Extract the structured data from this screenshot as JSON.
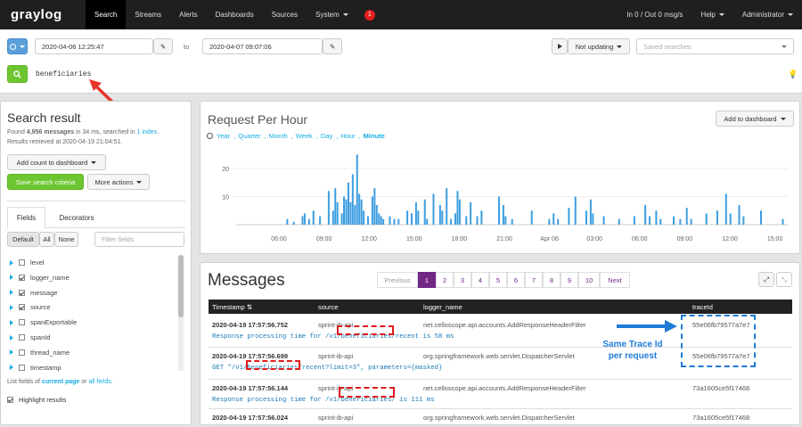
{
  "nav": {
    "logo": "graylog",
    "items": [
      "Search",
      "Streams",
      "Alerts",
      "Dashboards",
      "Sources",
      "System"
    ],
    "badge": "1",
    "throughput": "In 0 / Out 0 msg/s",
    "help": "Help",
    "user": "Administrator"
  },
  "search": {
    "from": "2020-04-06 12:25:47",
    "to_label": "to",
    "to": "2020-04-07 09:07:06",
    "updating": "Not updating",
    "saved_placeholder": "Saved searches",
    "query": "beneficiaries"
  },
  "result": {
    "title": "Search result",
    "found_prefix": "Found ",
    "count": "4,956 messages",
    "found_mid": " in 34 ms, searched in ",
    "index": "1 index",
    "found_suffix": ".",
    "retrieved": "Results retrieved at 2020-04-19 21:04:51.",
    "add_count": "Add count to dashboard",
    "save": "Save search criteria",
    "more": "More actions"
  },
  "fields_panel": {
    "tabs": [
      "Fields",
      "Decorators"
    ],
    "filters": [
      "Default",
      "All",
      "None"
    ],
    "filter_placeholder": "Filter fields",
    "fields": [
      {
        "name": "level",
        "checked": false
      },
      {
        "name": "logger_name",
        "checked": true
      },
      {
        "name": "message",
        "checked": true
      },
      {
        "name": "source",
        "checked": true
      },
      {
        "name": "spanExportable",
        "checked": false
      },
      {
        "name": "spanId",
        "checked": false
      },
      {
        "name": "thread_name",
        "checked": false
      },
      {
        "name": "timestamp",
        "checked": false
      }
    ],
    "list_prefix": "List fields of ",
    "current_page": "current page",
    "or": " or ",
    "all_fields": "all fields",
    "period": ".",
    "highlight": "Highlight results"
  },
  "chart": {
    "title": "Request Per Hour",
    "add": "Add to dashboard",
    "resolutions": [
      "Year",
      "Quarter",
      "Month",
      "Week",
      "Day",
      "Hour",
      "Minute"
    ],
    "active": "Minute"
  },
  "chart_data": {
    "type": "bar",
    "y_ticks": [
      10,
      20
    ],
    "ylim": [
      0,
      28
    ],
    "x_ticks": [
      "06:00",
      "09:00",
      "12:00",
      "15:00",
      "18:00",
      "21:00",
      "Apr 06",
      "03:00",
      "06:00",
      "09:00",
      "12:00",
      "15:00"
    ],
    "values": [
      [
        0.23,
        2
      ],
      [
        0.26,
        1
      ],
      [
        0.3,
        3
      ],
      [
        0.31,
        4
      ],
      [
        0.33,
        2
      ],
      [
        0.35,
        5
      ],
      [
        0.38,
        3
      ],
      [
        0.42,
        12
      ],
      [
        0.44,
        5
      ],
      [
        0.45,
        13
      ],
      [
        0.46,
        8
      ],
      [
        0.48,
        4
      ],
      [
        0.49,
        10
      ],
      [
        0.5,
        9
      ],
      [
        0.51,
        15
      ],
      [
        0.52,
        8
      ],
      [
        0.53,
        18
      ],
      [
        0.54,
        7
      ],
      [
        0.55,
        25
      ],
      [
        0.56,
        11
      ],
      [
        0.57,
        9
      ],
      [
        0.58,
        5
      ],
      [
        0.6,
        3
      ],
      [
        0.62,
        10
      ],
      [
        0.63,
        13
      ],
      [
        0.64,
        7
      ],
      [
        0.65,
        4
      ],
      [
        0.66,
        3
      ],
      [
        0.67,
        2
      ],
      [
        0.7,
        3
      ],
      [
        0.72,
        2
      ],
      [
        0.74,
        2
      ],
      [
        0.78,
        5
      ],
      [
        0.8,
        4
      ],
      [
        0.82,
        8
      ],
      [
        0.83,
        5
      ],
      [
        0.86,
        9
      ],
      [
        0.87,
        2
      ],
      [
        0.9,
        11
      ],
      [
        0.93,
        7
      ],
      [
        0.94,
        5
      ],
      [
        0.96,
        13
      ],
      [
        0.98,
        2
      ],
      [
        1.0,
        4
      ],
      [
        1.01,
        12
      ],
      [
        1.02,
        9
      ],
      [
        1.05,
        3
      ],
      [
        1.07,
        8
      ],
      [
        1.1,
        3
      ],
      [
        1.12,
        5
      ],
      [
        1.2,
        10
      ],
      [
        1.22,
        7
      ],
      [
        1.23,
        3
      ],
      [
        1.26,
        2
      ],
      [
        1.35,
        5
      ],
      [
        1.43,
        2
      ],
      [
        1.45,
        4
      ],
      [
        1.47,
        2
      ],
      [
        1.52,
        6
      ],
      [
        1.55,
        10
      ],
      [
        1.6,
        5
      ],
      [
        1.62,
        9
      ],
      [
        1.63,
        4
      ],
      [
        1.68,
        3
      ],
      [
        1.75,
        2
      ],
      [
        1.82,
        3
      ],
      [
        1.87,
        7
      ],
      [
        1.89,
        3
      ],
      [
        1.92,
        5
      ],
      [
        1.94,
        2
      ],
      [
        2.0,
        3
      ],
      [
        2.03,
        2
      ],
      [
        2.06,
        6
      ],
      [
        2.08,
        2
      ],
      [
        2.15,
        4
      ],
      [
        2.2,
        5
      ],
      [
        2.24,
        11
      ],
      [
        2.26,
        4
      ],
      [
        2.3,
        7
      ],
      [
        2.32,
        3
      ],
      [
        2.4,
        5
      ],
      [
        2.5,
        2
      ]
    ]
  },
  "messages": {
    "title": "Messages",
    "pages": [
      "Previous",
      "1",
      "2",
      "3",
      "4",
      "5",
      "6",
      "7",
      "8",
      "9",
      "10",
      "Next"
    ],
    "columns": [
      "Timestamp",
      "source",
      "logger_name",
      "traceId"
    ],
    "rows": [
      {
        "ts": "2020-04-19 17:57:56.752",
        "source": "sprint-ib-api",
        "logger": "net.celloscope.api.accounts.AddResponseHeaderFilter",
        "trace": "55e06fb79577a7e7",
        "msg": "Response processing time for /v1/beneficiaries/recent is 58 ms"
      },
      {
        "ts": "2020-04-19 17:57:56.699",
        "source": "sprint-ib-api",
        "logger": "org.springframework.web.servlet.DispatcherServlet",
        "trace": "55e06fb79577a7e7",
        "msg": "GET \"/v1/beneficiaries/recent?limit=3\", parameters={masked}"
      },
      {
        "ts": "2020-04-19 17:57:56.144",
        "source": "sprint-ib-api",
        "logger": "net.celloscope.api.accounts.AddResponseHeaderFilter",
        "trace": "73a1605ce5f17468",
        "msg": "Response processing time for /v1/beneficiaries/ is 111 ms"
      },
      {
        "ts": "2020-04-19 17:57:56.024",
        "source": "sprint-ib-api",
        "logger": "org.springframework.web.servlet.DispatcherServlet",
        "trace": "73a1605ce5f17468",
        "msg": ""
      }
    ]
  },
  "annotation": {
    "line1": "Same Trace Id",
    "line2": "per request"
  },
  "colors": {
    "accent": "#16ace3",
    "green": "#6dc631",
    "blue_btn": "#5a9fd9",
    "page_active": "#702785",
    "bar": "#3d9ee0"
  }
}
